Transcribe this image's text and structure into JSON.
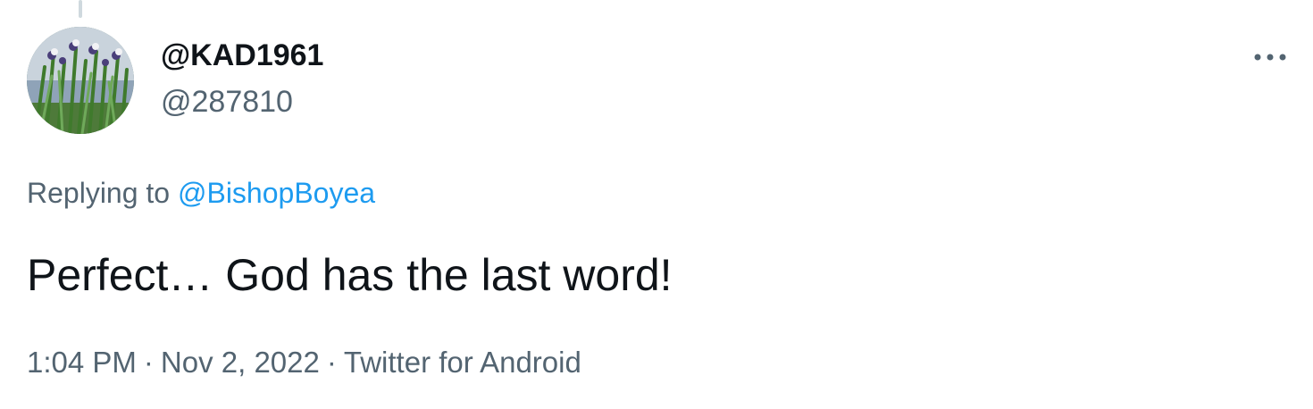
{
  "tweet": {
    "display_name": "@KAD1961",
    "handle": "@287810",
    "replying_prefix": "Replying to",
    "replying_to": "@BishopBoyea",
    "text": "Perfect… God has the last word!",
    "time": "1:04 PM",
    "separator": "·",
    "date": "Nov 2, 2022",
    "source": "Twitter for Android",
    "more_icon": "more-horizontal-icon",
    "avatar_icon": "avatar-image"
  },
  "colors": {
    "text_primary": "#0f1419",
    "text_secondary": "#536471",
    "link": "#1d9bf0",
    "thread_line": "#cfd9de"
  }
}
